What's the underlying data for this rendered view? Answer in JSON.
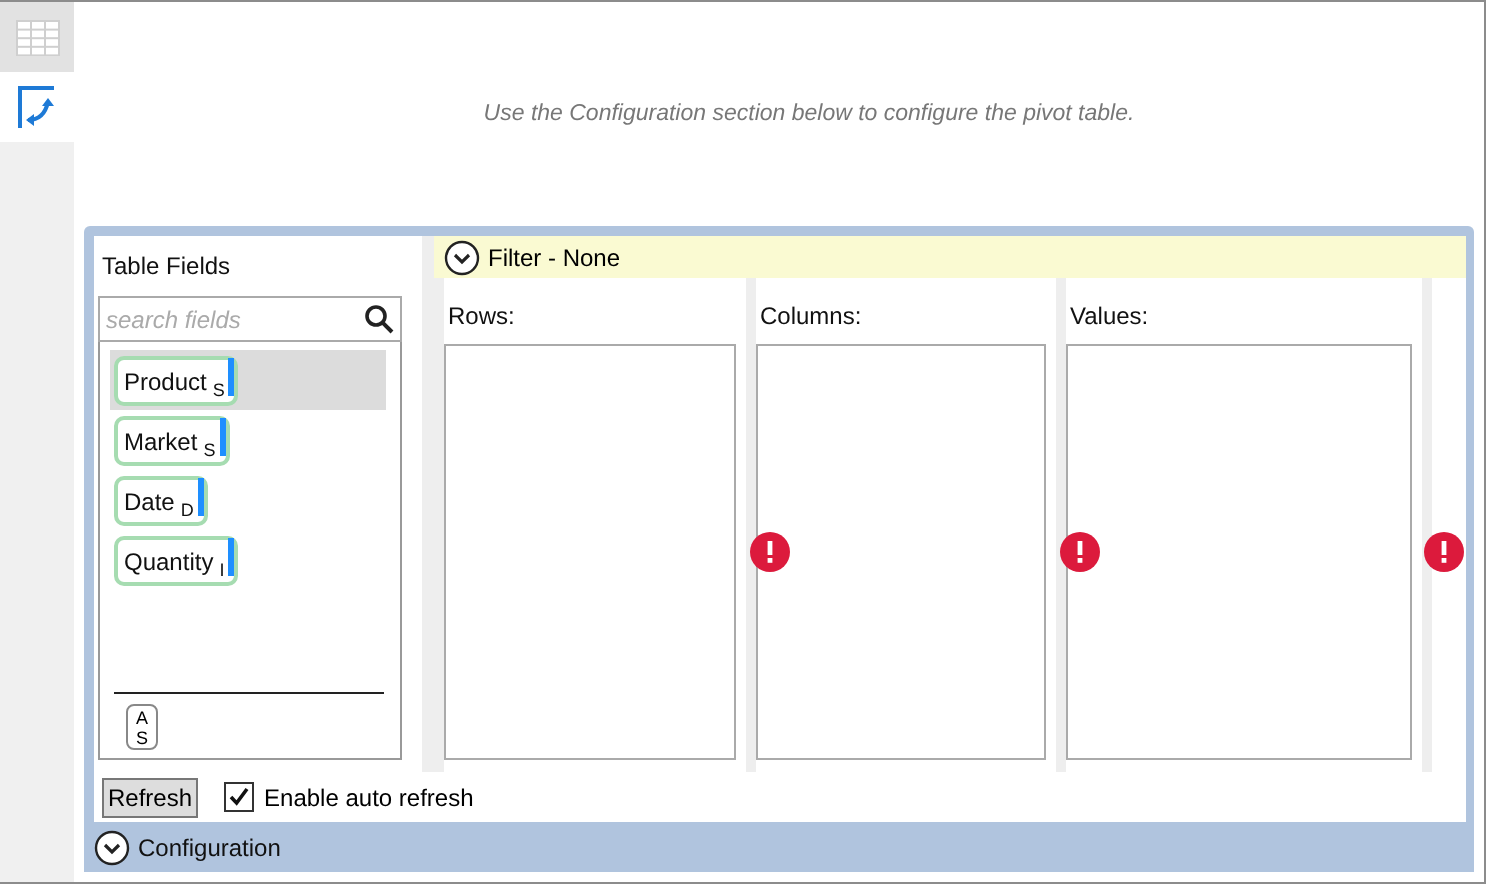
{
  "sidebar": {
    "items": [
      {
        "kind": "grid",
        "selected": false
      },
      {
        "kind": "pivot",
        "selected": true
      }
    ]
  },
  "instruction": "Use the Configuration section below to configure the pivot table.",
  "table_fields": {
    "title": "Table Fields",
    "search": {
      "placeholder": "search fields"
    },
    "fields": [
      {
        "name": "Product",
        "type": "S",
        "selected": true
      },
      {
        "name": "Market",
        "type": "S",
        "selected": false
      },
      {
        "name": "Date",
        "type": "D",
        "selected": false
      },
      {
        "name": "Quantity",
        "type": "I",
        "selected": false
      }
    ],
    "sort_button": {
      "top": "A",
      "bottom": "S"
    }
  },
  "filter": {
    "label": "Filter - None"
  },
  "zones": [
    {
      "label": "Rows:",
      "error": false
    },
    {
      "label": "Columns:",
      "error": true
    },
    {
      "label": "Values:",
      "error": true
    },
    {
      "error": true
    }
  ],
  "refresh_button": "Refresh",
  "auto_refresh": {
    "label": "Enable auto refresh",
    "checked": true
  },
  "configuration": {
    "label": "Configuration"
  }
}
